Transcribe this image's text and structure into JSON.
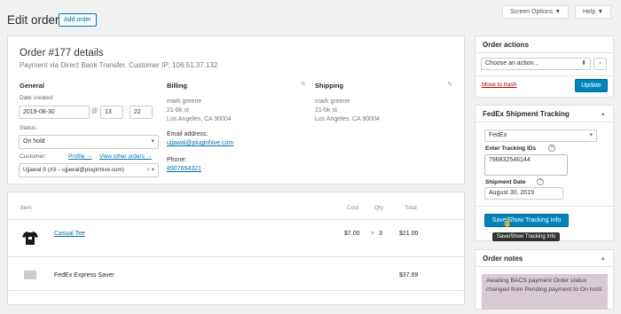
{
  "header": {
    "title": "Edit order",
    "add_order": "Add order",
    "screen_options": "Screen Options ▼",
    "help": "Help ▼"
  },
  "order": {
    "title": "Order #177 details",
    "subtitle": "Payment via Direct Bank Transfer. Customer IP: 106.51.37.132"
  },
  "general": {
    "heading": "General",
    "date_label": "Date created:",
    "date_value": "2019-08-30",
    "at": "@",
    "hour": "13",
    "colon": ":",
    "minute": "22",
    "status_label": "Status:",
    "status_value": "On hold",
    "customer_label": "Customer:",
    "profile_link": "Profile →",
    "other_orders_link": "View other orders →",
    "customer_value": "Ujjawal S (#3 – ujjawal@pluginhive.com)"
  },
  "billing": {
    "heading": "Billing",
    "name": "mark greene",
    "street": "21-bk st",
    "city": "Los Angeles, CA 90004",
    "email_label": "Email address:",
    "email": "ujjawal@pluginhive.com",
    "phone_label": "Phone:",
    "phone": "8907654321"
  },
  "shipping": {
    "heading": "Shipping",
    "name": "mark greene",
    "street": "21-bk st",
    "city": "Los Angeles, CA 90004"
  },
  "items": {
    "col_item": "Item",
    "col_cost": "Cost",
    "col_qty": "Qty",
    "col_total": "Total",
    "rows": [
      {
        "name": "Casual Tee",
        "cost": "$7.00",
        "times": "×",
        "qty": "3",
        "total": "$21.00"
      }
    ],
    "shipping_row": {
      "name": "FedEx Express Saver",
      "total": "$37.69"
    }
  },
  "order_actions": {
    "heading": "Order actions",
    "select_value": "Choose an action...",
    "go": "›",
    "trash": "Move to trash",
    "update": "Update"
  },
  "fedex": {
    "heading": "FedEx Shipment Tracking",
    "carrier": "FedEx",
    "ids_label": "Enter Tracking IDs",
    "ids_value": "786832546144",
    "date_label": "Shipment Date",
    "date_value": "August 30, 2019",
    "button": "Save/Show Tracking Info",
    "tooltip": "Save/Show Tracking Info",
    "help_glyph": "?"
  },
  "notes": {
    "heading": "Order notes",
    "note": "Awaiting BACS payment Order status changed from Pending payment to On hold."
  },
  "colors": {
    "accent": "#0073aa",
    "button": "#0085ba",
    "trash": "#a00",
    "note_bg": "#d7cad2"
  }
}
